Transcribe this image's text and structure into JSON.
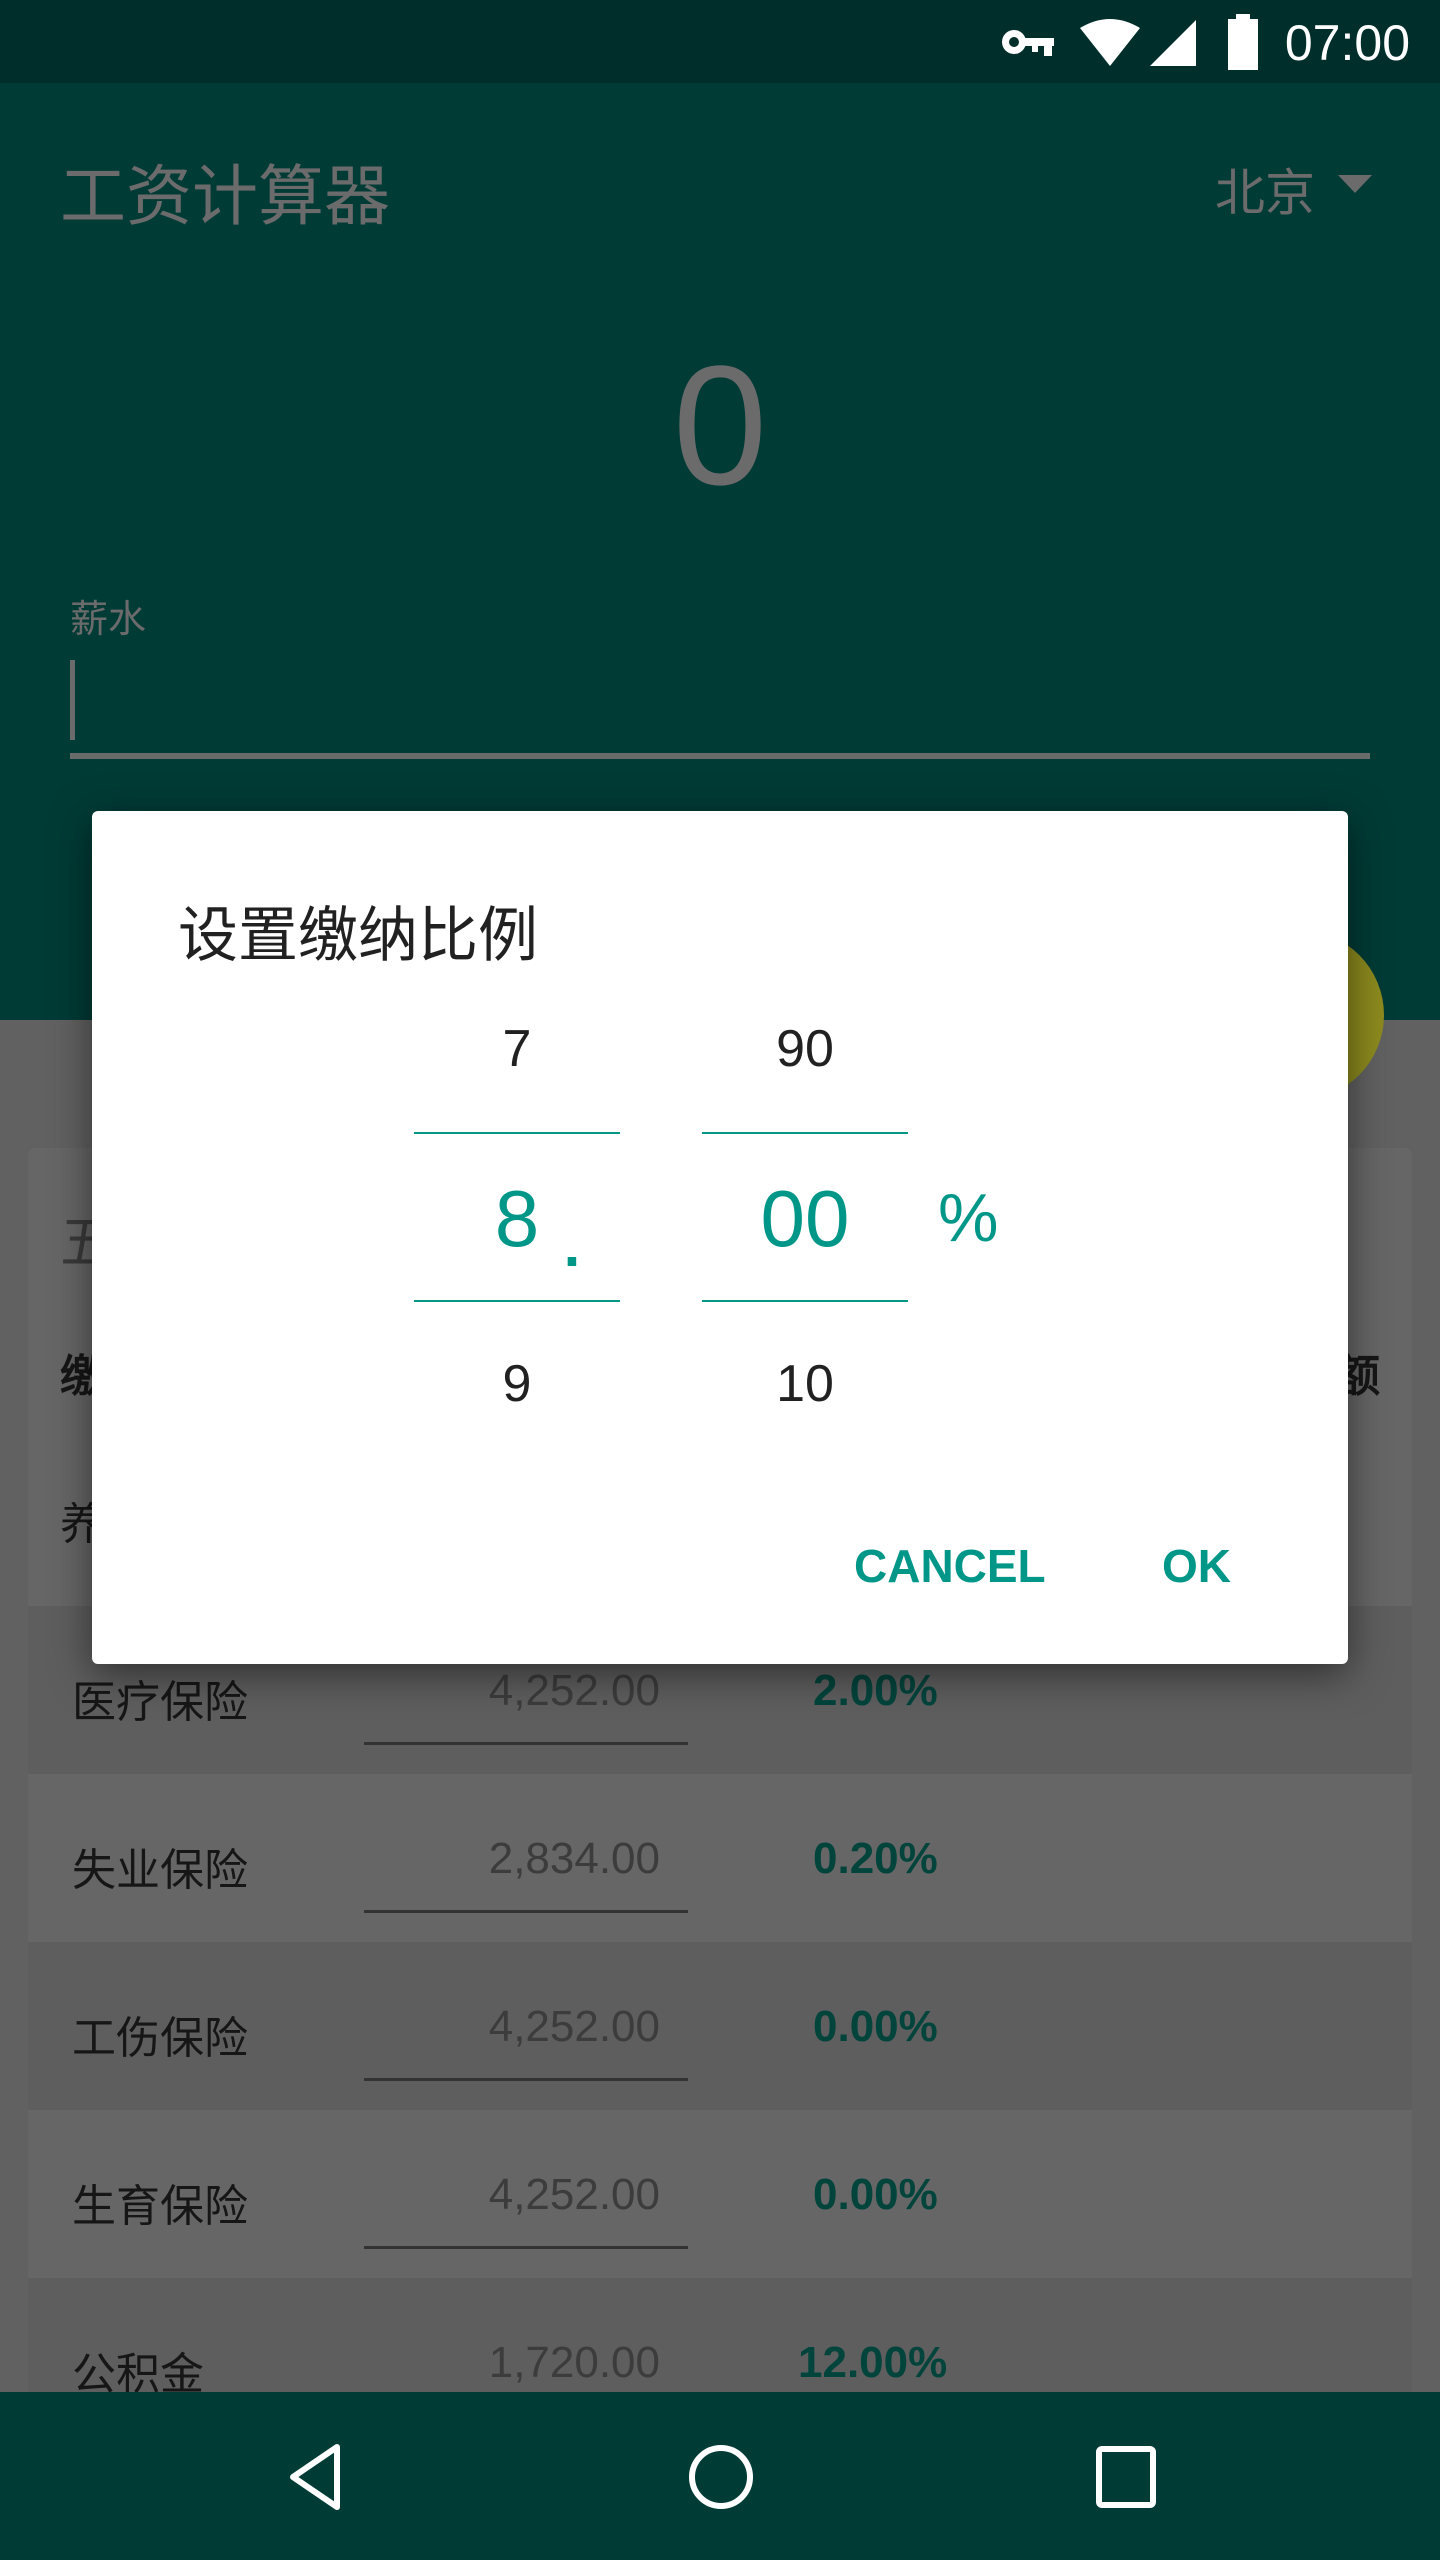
{
  "status_bar": {
    "time": "07:00",
    "icons": [
      "vpn-key-icon",
      "wifi-icon",
      "signal-icon",
      "battery-icon"
    ]
  },
  "header": {
    "title": "工资计算器",
    "city": "北京",
    "result": "0",
    "salary_label": "薪水",
    "salary_value": ""
  },
  "card": {
    "title_partial": "五",
    "col_left_partial": "缴",
    "col_right_partial": "额",
    "first_row_partial": "养",
    "rows": [
      {
        "name": "医疗保险",
        "base": "4,252.00",
        "rate": "2.00%"
      },
      {
        "name": "失业保险",
        "base": "2,834.00",
        "rate": "0.20%"
      },
      {
        "name": "工伤保险",
        "base": "4,252.00",
        "rate": "0.00%"
      },
      {
        "name": "生育保险",
        "base": "4,252.00",
        "rate": "0.00%"
      },
      {
        "name": "公积金",
        "base": "1,720.00",
        "rate": "12.00%"
      }
    ]
  },
  "dialog": {
    "title": "设置缴纳比例",
    "integer": {
      "prev": "7",
      "selected": "8",
      "next": "9"
    },
    "decimal_point": ".",
    "fraction": {
      "prev": "90",
      "selected": "00",
      "next": "10"
    },
    "unit": "%",
    "cancel": "CANCEL",
    "ok": "OK"
  },
  "colors": {
    "accent": "#009688",
    "primary_dark": "#003b36",
    "fab": "#8c8a1e"
  },
  "nav": {
    "icons": [
      "back-icon",
      "home-icon",
      "recents-icon"
    ]
  }
}
